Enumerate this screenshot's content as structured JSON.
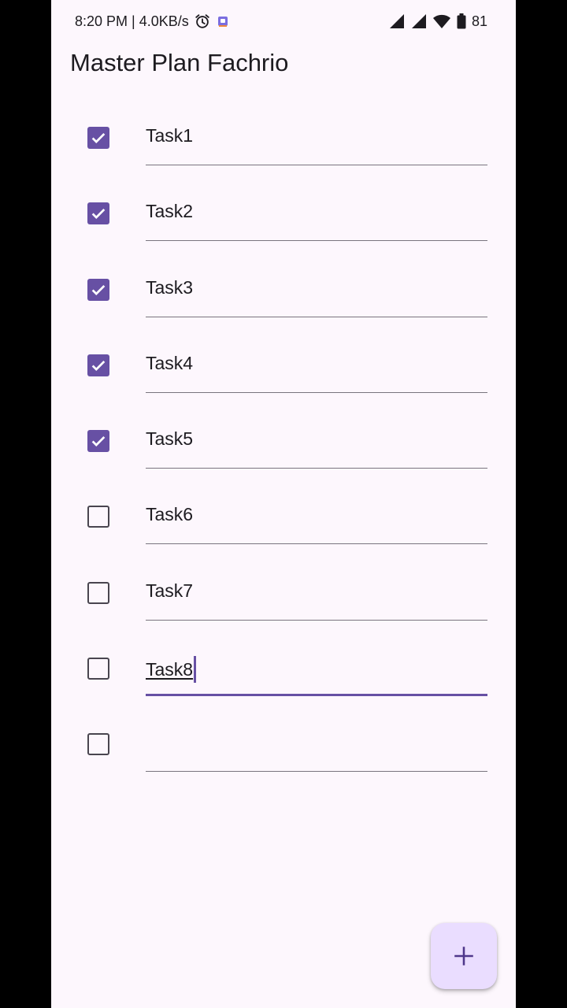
{
  "status_bar": {
    "time_speed": "8:20 PM | 4.0KB/s",
    "battery_level": "81",
    "icons": [
      "alarm-icon",
      "notification-app-icon",
      "signal-icon",
      "signal-icon",
      "wifi-icon",
      "battery-icon"
    ]
  },
  "app_bar": {
    "title": "Master Plan Fachrio"
  },
  "tasks": [
    {
      "text": "Task1",
      "checked": true
    },
    {
      "text": "Task2",
      "checked": true
    },
    {
      "text": "Task3",
      "checked": true
    },
    {
      "text": "Task4",
      "checked": true
    },
    {
      "text": "Task5",
      "checked": true
    },
    {
      "text": "Task6",
      "checked": false
    },
    {
      "text": "Task7",
      "checked": false
    },
    {
      "text": "Task8",
      "checked": false,
      "focused": true
    },
    {
      "text": "",
      "checked": false
    }
  ],
  "fab": {
    "icon": "plus-icon"
  },
  "colors": {
    "primary": "#6750a4",
    "background": "#fdf7fd",
    "fab_container": "#eaddff"
  }
}
